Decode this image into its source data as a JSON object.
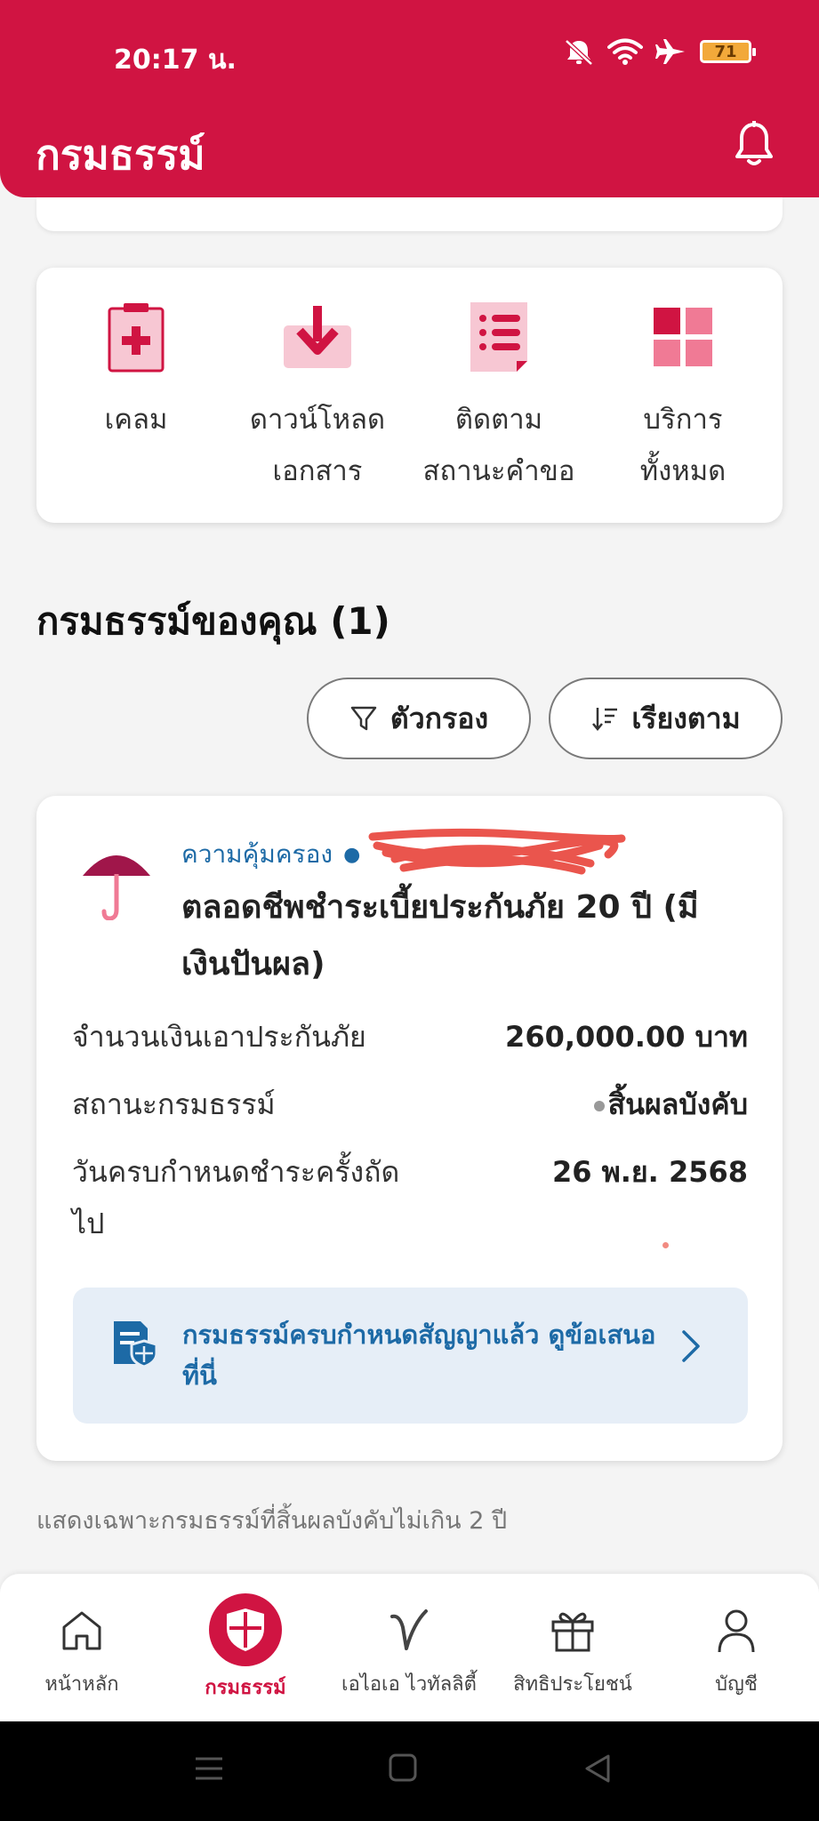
{
  "status_bar": {
    "time": "20:17 น.",
    "battery": "71"
  },
  "header": {
    "title": "กรมธรรม์"
  },
  "quick_actions": [
    {
      "line1": "เคลม",
      "line2": "",
      "icon": "claim-clipboard-icon"
    },
    {
      "line1": "ดาวน์โหลด",
      "line2": "เอกสาร",
      "icon": "download-icon"
    },
    {
      "line1": "ติดตาม",
      "line2": "สถานะคำขอ",
      "icon": "document-list-icon"
    },
    {
      "line1": "บริการ",
      "line2": "ทั้งหมด",
      "icon": "grid-icon"
    }
  ],
  "section": {
    "title": "กรมธรรม์ของคุณ (1)"
  },
  "toolbar": {
    "filter_label": "ตัวกรอง",
    "sort_label": "เรียงตาม"
  },
  "policy": {
    "coverage_label": "ความคุ้มครอง",
    "name": "ตลอดชีพชำระเบี้ยประกันภัย 20 ปี (มีเงินปันผล)",
    "rows": [
      {
        "label": "จำนวนเงินเอาประกันภัย",
        "value": "260,000.00 บาท"
      },
      {
        "label": "สถานะกรมธรรม์",
        "value": "สิ้นผลบังคับ"
      },
      {
        "label": "วันครบกำหนดชำระครั้งถัดไป",
        "value": "26 พ.ย. 2568"
      }
    ],
    "notice": "กรมธรรม์ครบกำหนดสัญญาแล้ว ดูข้อเสนอที่นี่"
  },
  "footnote": "แสดงเฉพาะกรมธรรม์ที่สิ้นผลบังคับไม่เกิน 2 ปี",
  "bottom_nav": [
    {
      "label": "หน้าหลัก",
      "icon": "home-icon"
    },
    {
      "label": "กรมธรรม์",
      "icon": "shield-icon",
      "active": true
    },
    {
      "label": "เอไอเอ ไวทัลลิตี้",
      "icon": "vitality-check-icon"
    },
    {
      "label": "สิทธิประโยชน์",
      "icon": "gift-icon"
    },
    {
      "label": "บัญชี",
      "icon": "account-icon"
    }
  ],
  "colors": {
    "brand": "#d01442",
    "link": "#1d6aa6",
    "notice_bg": "#e6eef7"
  }
}
